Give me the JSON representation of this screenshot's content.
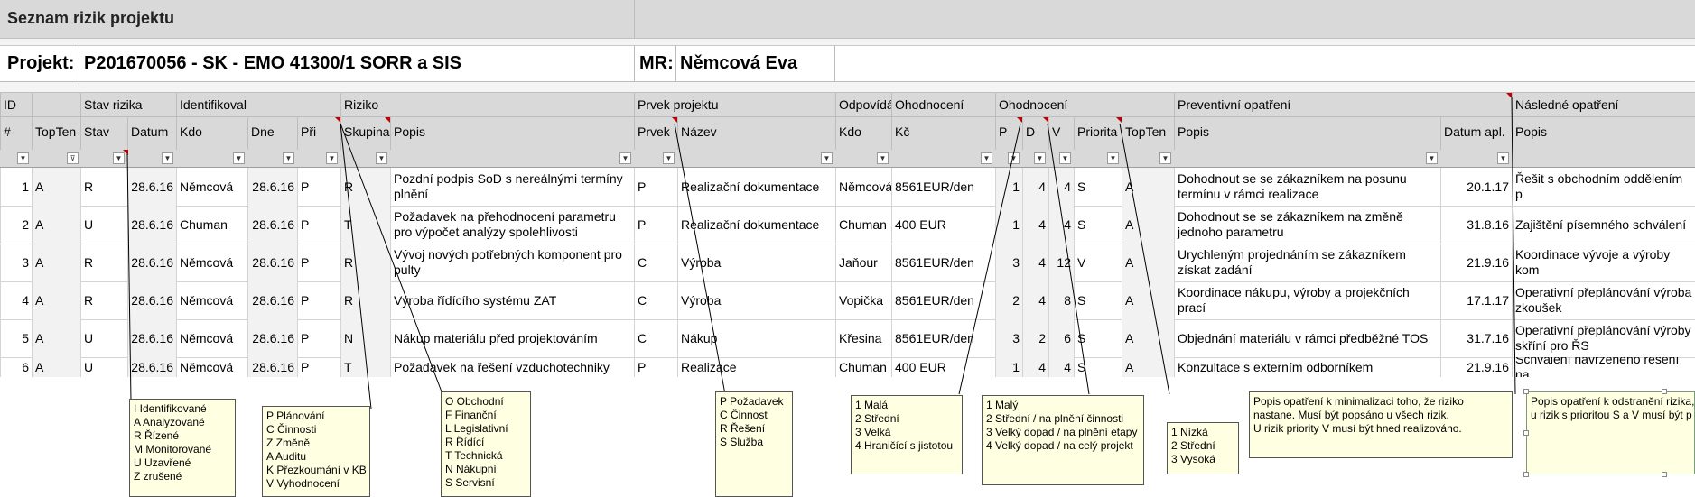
{
  "title": "Seznam rizik projektu",
  "project": {
    "label": "Projekt:",
    "value": "P201670056 - SK - EMO 41300/1 SORR a SIS",
    "mr_label": "MR:",
    "mr_value": "Němcová Eva"
  },
  "group_headers": [
    "ID",
    "Stav rizika",
    "Identifikoval",
    "Riziko",
    "Prvek projektu",
    "Odpovídá",
    "Ohodnocení",
    "Ohodnocení",
    "Preventivní opatření",
    "Následné opatření"
  ],
  "columns": [
    "#",
    "TopTen",
    "Stav",
    "Datum",
    "Kdo",
    "Dne",
    "Při",
    "Skupina",
    "Popis",
    "Prvek",
    "Název",
    "Kdo",
    "Kč",
    "P",
    "D",
    "V",
    "Priorita",
    "TopTen",
    "Popis",
    "Datum apl.",
    "Popis"
  ],
  "rows": [
    [
      "1",
      "A",
      "R",
      "28.6.16",
      "Němcová",
      "28.6.16",
      "P",
      "R",
      "Pozdní podpis SoD s nereálnými termíny plnění",
      "P",
      "Realizační dokumentace",
      "Němcová",
      "8561EUR/den",
      "1",
      "4",
      "4",
      "S",
      "A",
      "Dohodnout se se zákazníkem na posunu termínu v rámci realizace",
      "20.1.17",
      "Řešit s obchodním oddělením p"
    ],
    [
      "2",
      "A",
      "U",
      "28.6.16",
      "Chuman",
      "28.6.16",
      "P",
      "T",
      "Požadavek na přehodnocení parametru pro výpočet analýzy spolehlivosti",
      "P",
      "Realizační dokumentace",
      "Chuman",
      "400 EUR",
      "1",
      "4",
      "4",
      "S",
      "A",
      "Dohodnout se se zákazníkem na změně jednoho parametru",
      "31.8.16",
      "Zajištění písemného schválení"
    ],
    [
      "3",
      "A",
      "R",
      "28.6.16",
      "Němcová",
      "28.6.16",
      "P",
      "R",
      "Vývoj nových potřebných komponent pro pulty",
      "C",
      "Výroba",
      "Jaňour",
      "8561EUR/den",
      "3",
      "4",
      "12",
      "V",
      "A",
      "Urychleným projednáním se zákazníkem získat zadání",
      "21.9.16",
      "Koordinace vývoje a výroby kom"
    ],
    [
      "4",
      "A",
      "R",
      "28.6.16",
      "Němcová",
      "28.6.16",
      "P",
      "R",
      "Výroba řídícího systému ZAT",
      "C",
      "Výroba",
      "Vopička",
      "8561EUR/den",
      "2",
      "4",
      "8",
      "S",
      "A",
      "Koordinace nákupu, výroby a projekčních prací",
      "17.1.17",
      "Operativní přeplánování výroba zkoušek"
    ],
    [
      "5",
      "A",
      "U",
      "28.6.16",
      "Němcová",
      "28.6.16",
      "P",
      "N",
      "Nákup materiálu před projektováním",
      "C",
      "Nákup",
      "Křesina",
      "8561EUR/den",
      "3",
      "2",
      "6",
      "S",
      "A",
      "Objednání materiálu v rámci předběžné TOS",
      "31.7.16",
      "Operativní přeplánování výroby skříní pro ŘS"
    ],
    [
      "6",
      "A",
      "U",
      "28.6.16",
      "Němcová",
      "28.6.16",
      "P",
      "T",
      "Požadavek na řešení vzduchotechniky",
      "P",
      "Realizace",
      "Chuman",
      "400 EUR",
      "1",
      "4",
      "4",
      "S",
      "A",
      "Konzultace s externím odborníkem",
      "21.9.16",
      "Schválení navrženého řešení na"
    ]
  ],
  "notes": {
    "stav": [
      "I Identifikované",
      "A Analyzované",
      "R Řízené",
      "M Monitorované",
      "U Uzavřené",
      "Z zrušené"
    ],
    "pri": [
      "P Plánování",
      "C Činnosti",
      "Z Změně",
      "A Auditu",
      "K Přezkoumání v KB",
      "V Vyhodnocení"
    ],
    "skupina": [
      "O Obchodní",
      "F Finanční",
      "L Legislativní",
      "R Řídící",
      "T Technická",
      "N Nákupní",
      "S Servisní"
    ],
    "prvek": [
      "P Požadavek",
      "C Činnost",
      "R Řešení",
      "S Služba"
    ],
    "p": [
      "1 Malá",
      "2 Střední",
      "3 Velká",
      "4 Hraničící s jistotou"
    ],
    "d": [
      "1 Malý",
      "2 Střední / na plnění činnosti",
      "3 Velký dopad / na plnění etapy",
      "4 Velký dopad / na celý projekt"
    ],
    "priorita": [
      "1 Nízká",
      "2 Střední",
      "3 Vysoká"
    ],
    "preventivni": [
      "Popis opatření k minimalizaci toho, že riziko nastane. Musí být popsáno u všech rizik.",
      "U rizik priority V musí být hned realizováno."
    ],
    "nasledne": [
      "Popis opatření k odstranění rizika,",
      "u rizik s prioritou S a V musí být p"
    ]
  },
  "colors": {
    "header_bg": "#d9d9d9",
    "note_bg": "#ffffe1",
    "comment_marker": "#c00000"
  }
}
